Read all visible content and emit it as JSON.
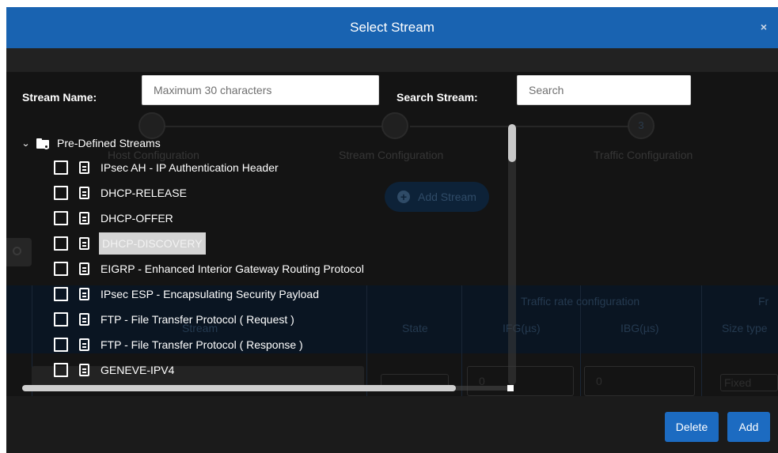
{
  "modal": {
    "title": "Select Stream",
    "close_label": "×"
  },
  "form": {
    "stream_name_label": "Stream Name:",
    "stream_name_placeholder": "Maximum 30 characters",
    "search_label": "Search Stream:",
    "search_placeholder": "Search"
  },
  "tree": {
    "root_label": "Pre-Defined Streams",
    "items": [
      {
        "label": "IPsec AH - IP Authentication Header",
        "checked": false
      },
      {
        "label": "DHCP-RELEASE",
        "checked": false
      },
      {
        "label": "DHCP-OFFER",
        "checked": false
      },
      {
        "label": "DHCP-DISCOVERY",
        "checked": false,
        "selected": true
      },
      {
        "label": "EIGRP - Enhanced Interior Gateway Routing Protocol",
        "checked": false
      },
      {
        "label": "IPsec ESP - Encapsulating Security Payload",
        "checked": false
      },
      {
        "label": "FTP - File Transfer Protocol ( Request )",
        "checked": false
      },
      {
        "label": "FTP - File Transfer Protocol ( Response )",
        "checked": false
      },
      {
        "label": "GENEVE-IPV4",
        "checked": false
      }
    ]
  },
  "background": {
    "steps": [
      "Host Configuration",
      "Stream Configuration",
      "Traffic Configuration"
    ],
    "step3_number": "3",
    "add_stream_label": "Add Stream",
    "table": {
      "traffic_rate_header": "Traffic rate configuration",
      "frame_header": "Fr",
      "stream_header": "Stream",
      "state_header": "State",
      "ifg_header": "IFG(µs)",
      "ibg_header": "IBG(µs)",
      "size_type_header": "Size type",
      "ifg_value": "0",
      "ibg_value": "0",
      "size_value": "Fixed"
    }
  },
  "footer": {
    "delete_label": "Delete",
    "add_label": "Add"
  },
  "colors": {
    "header_blue": "#1963b1",
    "button_blue": "#1c6bc1",
    "selected_highlight": "#d4d4d4"
  }
}
